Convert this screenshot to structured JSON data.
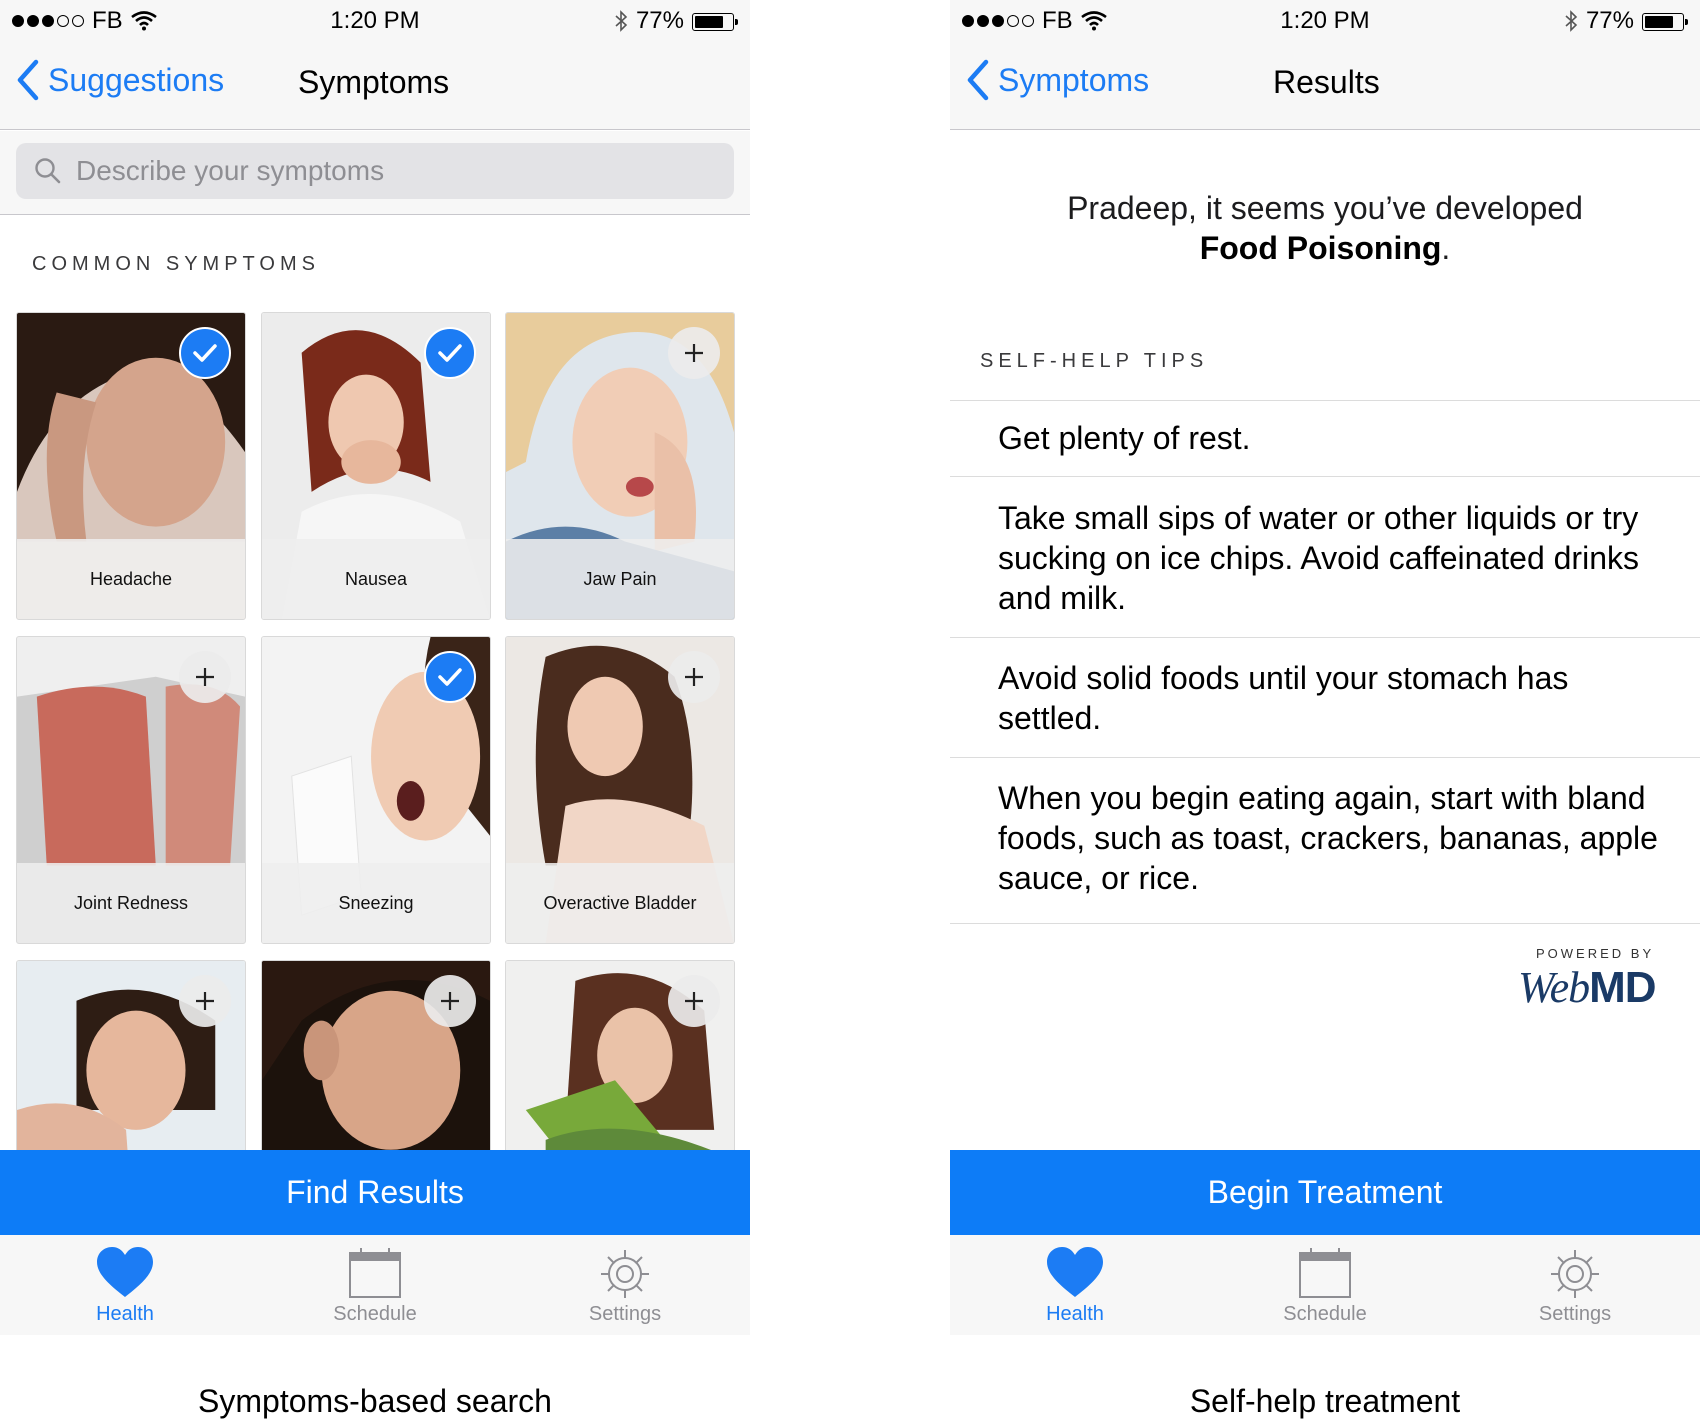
{
  "status_bar": {
    "carrier": "FB",
    "time": "1:20 PM",
    "battery_percent": "77%",
    "battery_level": 0.77
  },
  "colors": {
    "accent": "#1c7cf4",
    "action_button": "#0d7cf7",
    "bar_background": "#f7f7f7"
  },
  "left_screen": {
    "nav": {
      "back_label": "Suggestions",
      "title": "Symptoms"
    },
    "search": {
      "placeholder": "Describe your symptoms",
      "value": ""
    },
    "section_header": "COMMON SYMPTOMS",
    "tiles": [
      {
        "label": "Headache",
        "selected": true,
        "icon": "checkmark-icon"
      },
      {
        "label": "Nausea",
        "selected": true,
        "icon": "checkmark-icon"
      },
      {
        "label": "Jaw Pain",
        "selected": false,
        "icon": "plus-icon"
      },
      {
        "label": "Joint Redness",
        "selected": false,
        "icon": "plus-icon"
      },
      {
        "label": "Sneezing",
        "selected": true,
        "icon": "checkmark-icon"
      },
      {
        "label": "Overactive Bladder",
        "selected": false,
        "icon": "plus-icon"
      },
      {
        "label": "",
        "selected": false,
        "icon": "plus-icon"
      },
      {
        "label": "",
        "selected": false,
        "icon": "plus-icon"
      },
      {
        "label": "",
        "selected": false,
        "icon": "plus-icon"
      }
    ],
    "action_button": "Find Results",
    "caption": "Symptoms-based search"
  },
  "right_screen": {
    "nav": {
      "back_label": "Symptoms",
      "title": "Results"
    },
    "result_intro": "Pradeep, it seems you’ve developed",
    "diagnosis": "Food Poisoning",
    "diagnosis_suffix": ".",
    "section_header": "SELF-HELP TIPS",
    "tips": [
      "Get plenty of rest.",
      "Take small sips of water or other liquids or try sucking on ice chips. Avoid caffeinated drinks and milk.",
      "Avoid solid foods until your stomach has settled.",
      "When you begin eating again, start with bland foods, such as toast, crackers, bananas, apple sauce, or rice."
    ],
    "powered_by": "POWERED BY",
    "logo_web": "Web",
    "logo_md": "MD",
    "action_button": "Begin Treatment",
    "caption": "Self-help treatment"
  },
  "tab_bar": {
    "tabs": [
      {
        "label": "Health",
        "icon": "heart-icon",
        "active": true
      },
      {
        "label": "Schedule",
        "icon": "calendar-icon",
        "active": false
      },
      {
        "label": "Settings",
        "icon": "gear-icon",
        "active": false
      }
    ]
  }
}
